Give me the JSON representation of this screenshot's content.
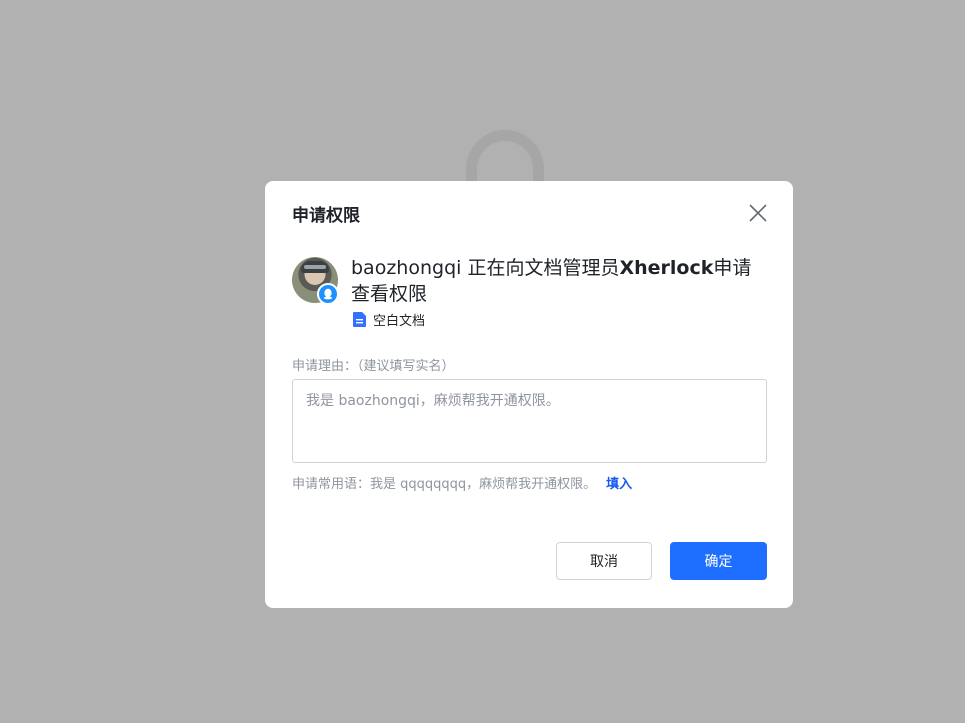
{
  "dialog": {
    "title": "申请权限",
    "requester": {
      "username": "baozhongqi",
      "text_middle": " 正在向文档管理员",
      "admin": "Xherlock",
      "text_end": "申请查看权限"
    },
    "document": {
      "name": "空白文档",
      "icon": "doc-icon"
    },
    "reason": {
      "label": "申请理由：（建议填写实名）",
      "placeholder": "我是 baozhongqi，麻烦帮我开通权限。",
      "value": ""
    },
    "common_phrase": {
      "text": "申请常用语：我是 qqqqqqqq，麻烦帮我开通权限。",
      "fill_label": "填入"
    },
    "buttons": {
      "cancel": "取消",
      "confirm": "确定"
    }
  },
  "colors": {
    "backdrop": "#b1b1b1",
    "primary": "#1e6fff",
    "link": "#1456f0",
    "muted_text": "#8f959e",
    "text": "#1f2329",
    "badge": "#1e90ff"
  }
}
